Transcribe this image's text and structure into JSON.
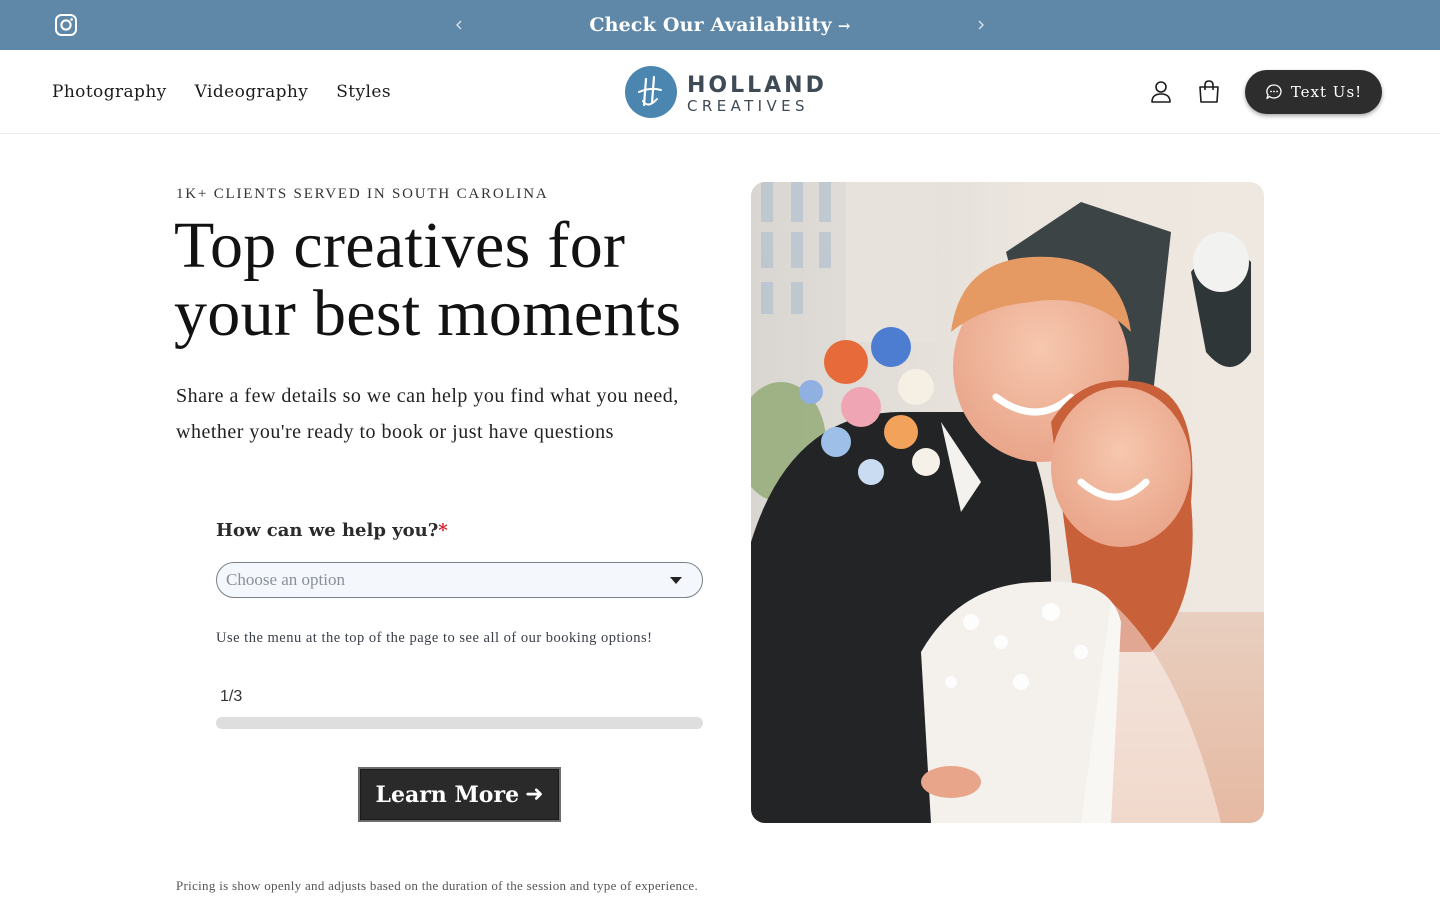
{
  "announcement": {
    "text": "Check Our Availability",
    "arrow": "→",
    "social_icon": "instagram-icon",
    "prev_icon": "chevron-left-icon",
    "next_icon": "chevron-right-icon",
    "background": "#5e87a8"
  },
  "header": {
    "nav": [
      {
        "label": "Photography"
      },
      {
        "label": "Videography"
      },
      {
        "label": "Styles"
      }
    ],
    "logo": {
      "line1": "HOLLAND",
      "line2": "CREATIVES",
      "color": "#4a86b0"
    },
    "account_icon": "user-icon",
    "cart_icon": "shopping-bag-icon",
    "cta": {
      "label": "Text Us!",
      "icon": "chat-bubble-icon"
    }
  },
  "hero": {
    "eyebrow": "1K+ CLIENTS SERVED IN SOUTH CAROLINA",
    "headline": "Top creatives for your best moments",
    "subtext": "Share a few details so we can help you find what you need, whether you're ready to book or just have questions"
  },
  "form": {
    "question": "How can we help you?",
    "required_mark": "*",
    "select_placeholder": "Choose an option",
    "hint": "Use the menu at the top of the page to see all of our booking options!",
    "step": "1/3",
    "progress": 0.0,
    "button": {
      "label": "Learn More",
      "arrow": "➜"
    }
  },
  "footnote": "Pricing is show openly and adjusts based on the duration of the session and type of experience."
}
